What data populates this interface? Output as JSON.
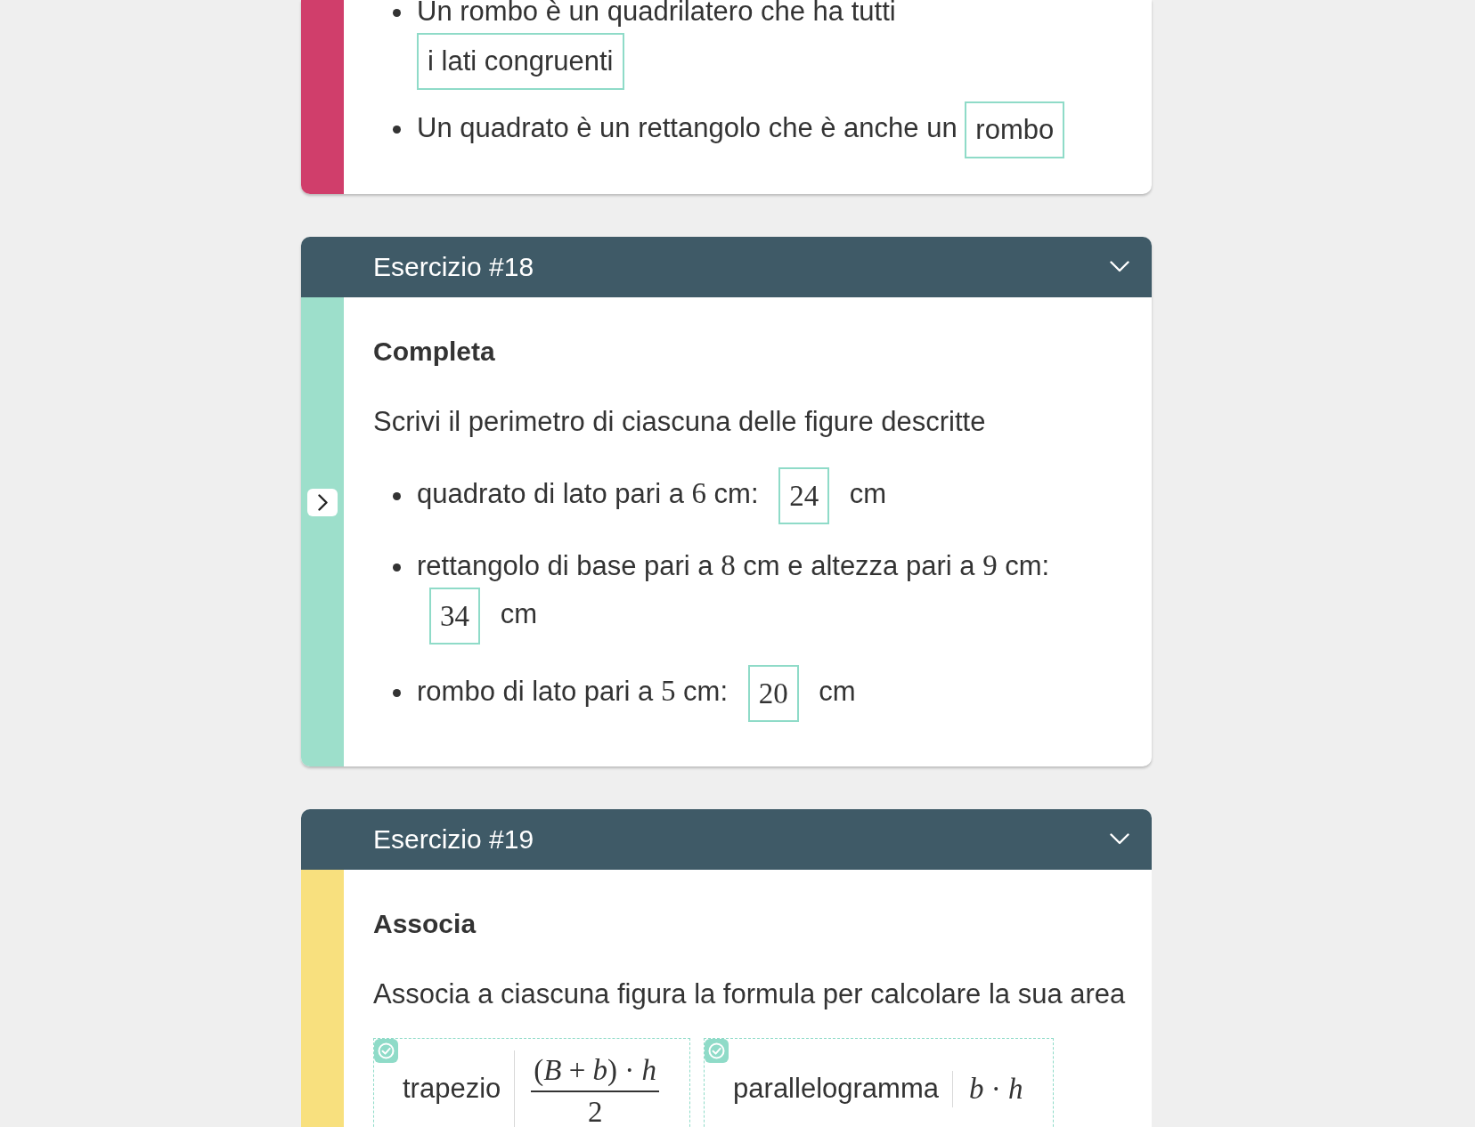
{
  "exercises": [
    {
      "kind": "fill_in",
      "color": "#d03e6b",
      "current": false,
      "items": [
        {
          "prompt": [
            {
              "kind": "text",
              "text": "Un rombo è un quadrilatero che ha tutti"
            }
          ],
          "answer": {
            "kind": "text",
            "value": "i lati congruenti"
          }
        },
        {
          "prompt": [
            {
              "kind": "text",
              "text": "Un quadrato è un rettangolo che è anche un"
            }
          ],
          "answer": {
            "kind": "text",
            "value": "rombo"
          }
        }
      ]
    },
    {
      "kind": "fill_in",
      "title": "Esercizio #18",
      "color": "#9ddfcb",
      "current": true,
      "type": "Completa",
      "instruction": "Scrivi il perimetro di ciascuna delle figure descritte",
      "items": [
        {
          "prompt": [
            {
              "kind": "text",
              "text": "quadrato di lato pari a "
            },
            {
              "kind": "math",
              "text": "6"
            },
            {
              "kind": "text",
              "text": " cm:"
            }
          ],
          "answer": {
            "kind": "math",
            "value": "24"
          },
          "unit": "cm"
        },
        {
          "prompt": [
            {
              "kind": "text",
              "text": "rettangolo di base pari a "
            },
            {
              "kind": "math",
              "text": "8"
            },
            {
              "kind": "text",
              "text": " cm e altezza pari a "
            },
            {
              "kind": "math",
              "text": "9"
            },
            {
              "kind": "text",
              "text": " cm:"
            }
          ],
          "answer": {
            "kind": "math",
            "value": "34"
          },
          "unit": "cm"
        },
        {
          "prompt": [
            {
              "kind": "text",
              "text": "rombo di lato pari a "
            },
            {
              "kind": "math",
              "text": "5"
            },
            {
              "kind": "text",
              "text": " cm:"
            }
          ],
          "answer": {
            "kind": "math",
            "value": "20"
          },
          "unit": "cm"
        }
      ]
    },
    {
      "kind": "match",
      "title": "Esercizio #19",
      "color": "#f8e07e",
      "current": false,
      "type": "Associa",
      "instruction": "Associa a ciascuna figura la formula per calcolare la sua area",
      "pairs": [
        {
          "figure": "trapezio",
          "formula": {
            "kind": "fraction",
            "numerator": "(*B* + *b*) · *h*",
            "denominator": "2"
          },
          "correct": true
        },
        {
          "figure": "parallelogramma",
          "formula": {
            "kind": "inline",
            "text": "*b* · *h*"
          },
          "correct": true
        }
      ]
    }
  ]
}
